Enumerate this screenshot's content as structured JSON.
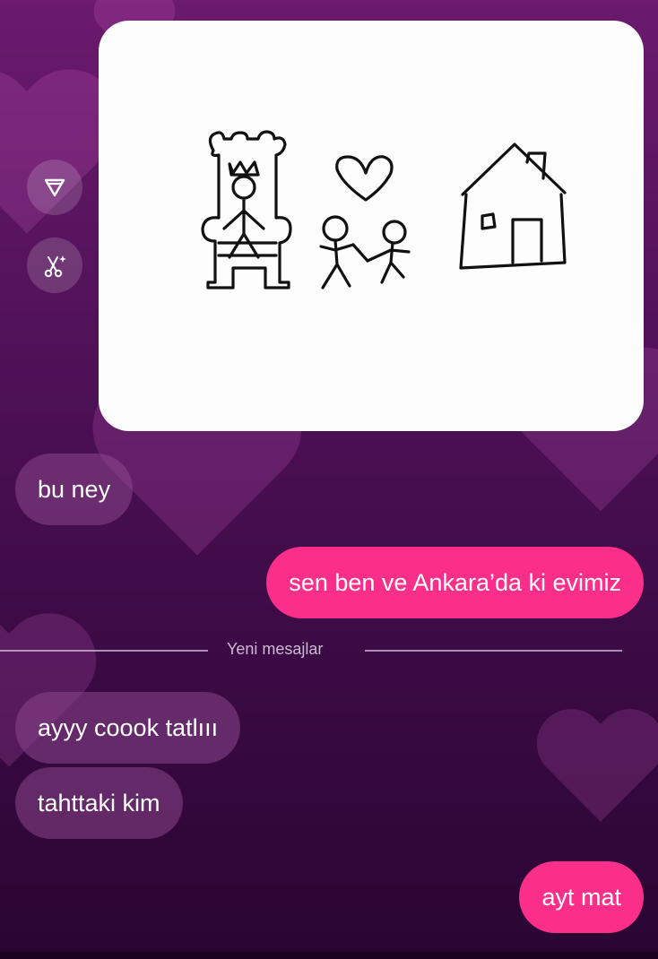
{
  "colors": {
    "outgoing_bubble": "#fb2f8a",
    "incoming_bubble": "rgba(140,70,140,0.55)",
    "background": "#4a0f52"
  },
  "side_actions": [
    {
      "icon": "send-triangle-icon"
    },
    {
      "icon": "sparkle-scissors-icon"
    }
  ],
  "shared_image": {
    "description_icons": [
      "throne-king-drawing",
      "heart-drawing",
      "two-stick-figures-drawing",
      "house-drawing"
    ]
  },
  "messages": [
    {
      "direction": "incoming",
      "text": "bu ney"
    },
    {
      "direction": "outgoing",
      "text": "sen ben ve Ankara’da ki evimiz"
    },
    {
      "direction": "incoming",
      "text": "ayyy coook tatlııı"
    },
    {
      "direction": "incoming",
      "text": "tahttaki kim"
    },
    {
      "direction": "outgoing",
      "text": "ayt mat"
    }
  ],
  "divider": {
    "label": "Yeni mesajlar"
  }
}
